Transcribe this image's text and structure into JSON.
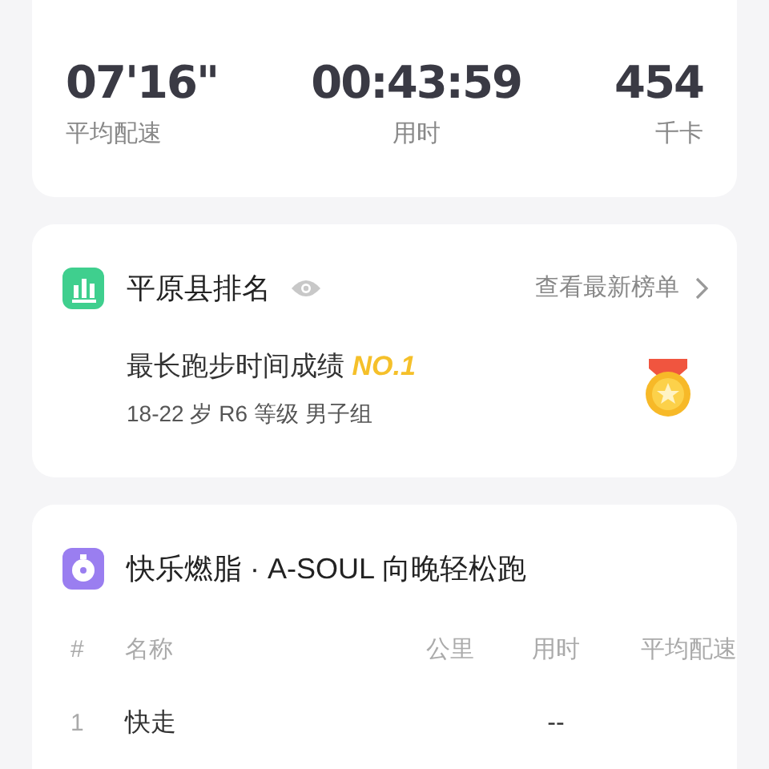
{
  "stats": [
    {
      "value": "07'16\"",
      "label": "平均配速"
    },
    {
      "value": "00:43:59",
      "label": "用时"
    },
    {
      "value": "454",
      "label": "千卡"
    }
  ],
  "ranking": {
    "title": "平原县排名",
    "link": "查看最新榜单",
    "achievement": "最长跑步时间成绩",
    "rank": "NO.1",
    "group": "18-22 岁 R6 等级 男子组"
  },
  "activity": {
    "title": "快乐燃脂 · A-SOUL 向晚轻松跑",
    "columns": [
      "#",
      "名称",
      "公里",
      "用时",
      "平均配速"
    ],
    "rows": [
      {
        "index": "1",
        "name": "快走",
        "duration": "--"
      }
    ]
  }
}
